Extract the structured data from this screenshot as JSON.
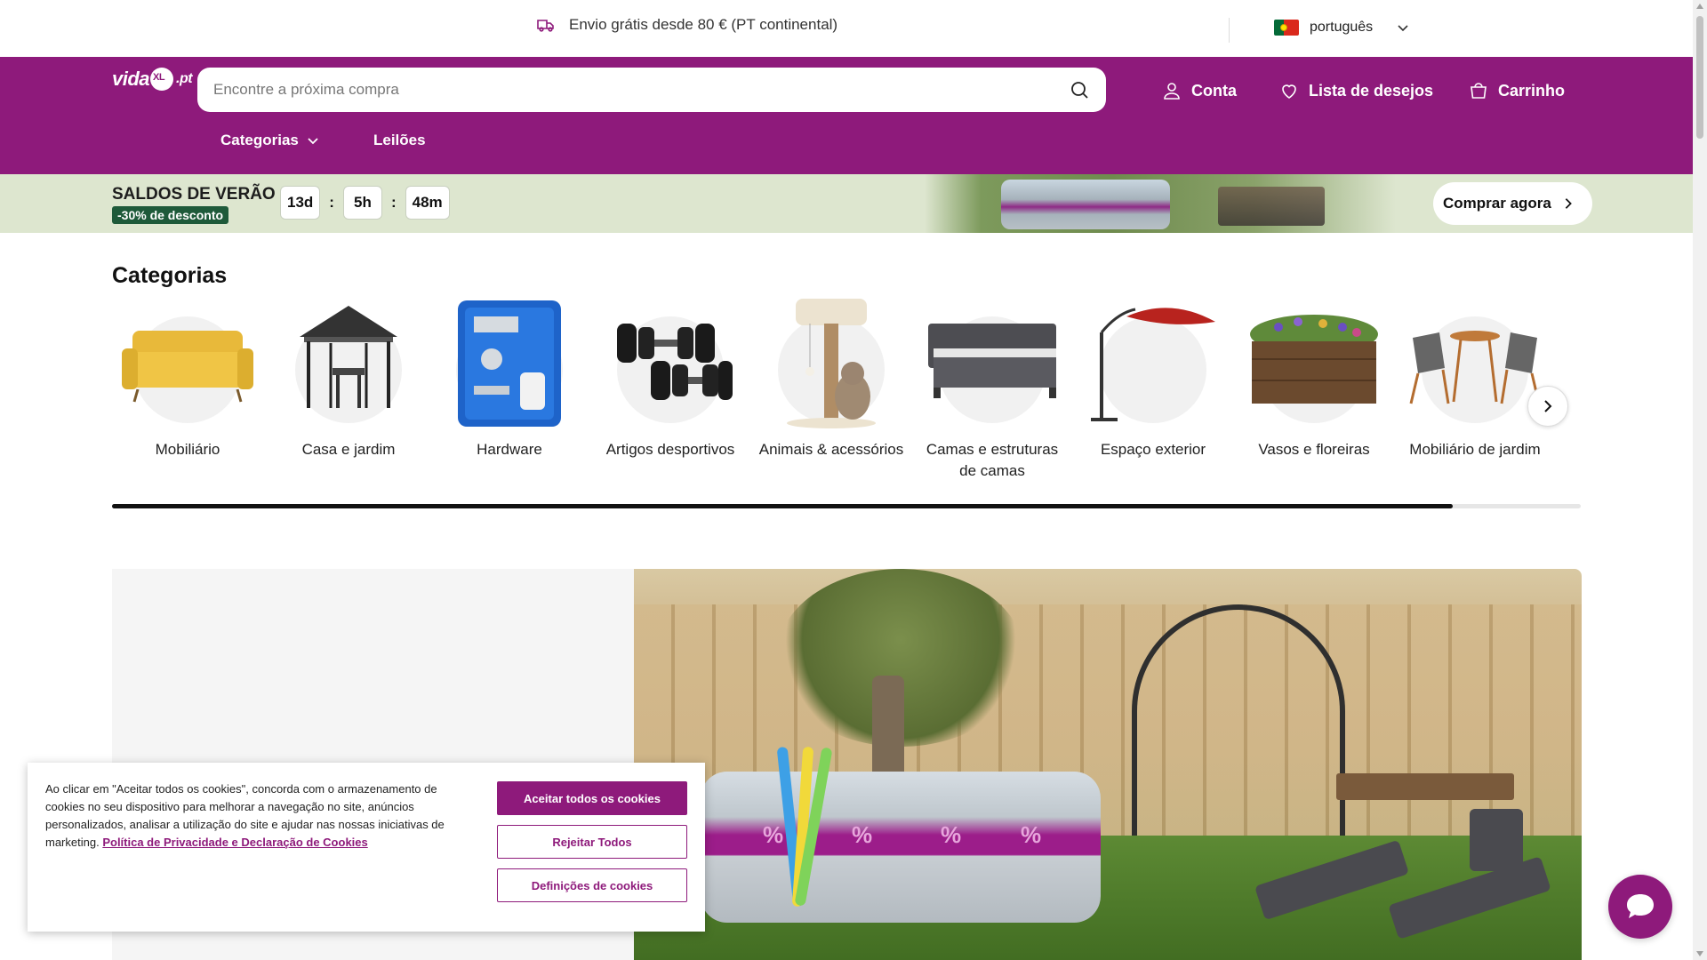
{
  "topbar": {
    "shipping_text": "Envio grátis desde 80 € (PT continental)",
    "language": "português"
  },
  "header": {
    "logo_text": "vida",
    "logo_suffix": ".pt",
    "search_placeholder": "Encontre a próxima compra",
    "account_label": "Conta",
    "wishlist_label": "Lista de desejos",
    "cart_label": "Carrinho",
    "nav": {
      "categories_label": "Categorias",
      "auctions_label": "Leilões"
    }
  },
  "sale": {
    "title": "SALDOS DE VERÃO",
    "badge": "-30% de desconto",
    "timer": {
      "days": "13d",
      "hours": "5h",
      "minutes": "48m",
      "separator": ":"
    },
    "cta_label": "Comprar agora"
  },
  "categories": {
    "title": "Categorias",
    "items": [
      {
        "label": "Mobiliário",
        "icon": "sofa-icon"
      },
      {
        "label": "Casa e jardim",
        "icon": "gazebo-icon"
      },
      {
        "label": "Hardware",
        "icon": "spray-gun-kit-icon"
      },
      {
        "label": "Artigos desportivos",
        "icon": "dumbbells-icon"
      },
      {
        "label": "Animais & acessórios",
        "icon": "cat-tree-icon"
      },
      {
        "label": "Camas e estruturas de camas",
        "icon": "bed-icon"
      },
      {
        "label": "Espaço exterior",
        "icon": "parasol-icon"
      },
      {
        "label": "Vasos e floreiras",
        "icon": "planter-icon"
      },
      {
        "label": "Mobiliário de jardim",
        "icon": "bistro-set-icon"
      }
    ],
    "scroll_progress": 0.913
  },
  "cookie": {
    "text": "Ao clicar em \"Aceitar todos os cookies\", concorda com o armazenamento de cookies no seu dispositivo para melhorar a navegação no site, anúncios personalizados, analisar a utilização do site e ajudar nas nossas iniciativas de marketing.",
    "link_text": "Política de Privacidade e Declaração de Cookies",
    "accept_label": "Aceitar todos os cookies",
    "reject_label": "Rejeitar Todos",
    "settings_label": "Definições de cookies"
  },
  "colors": {
    "brand": "#8e1a7b",
    "sale_bg": "#dde6cf",
    "sale_badge": "#1e5a3a"
  }
}
